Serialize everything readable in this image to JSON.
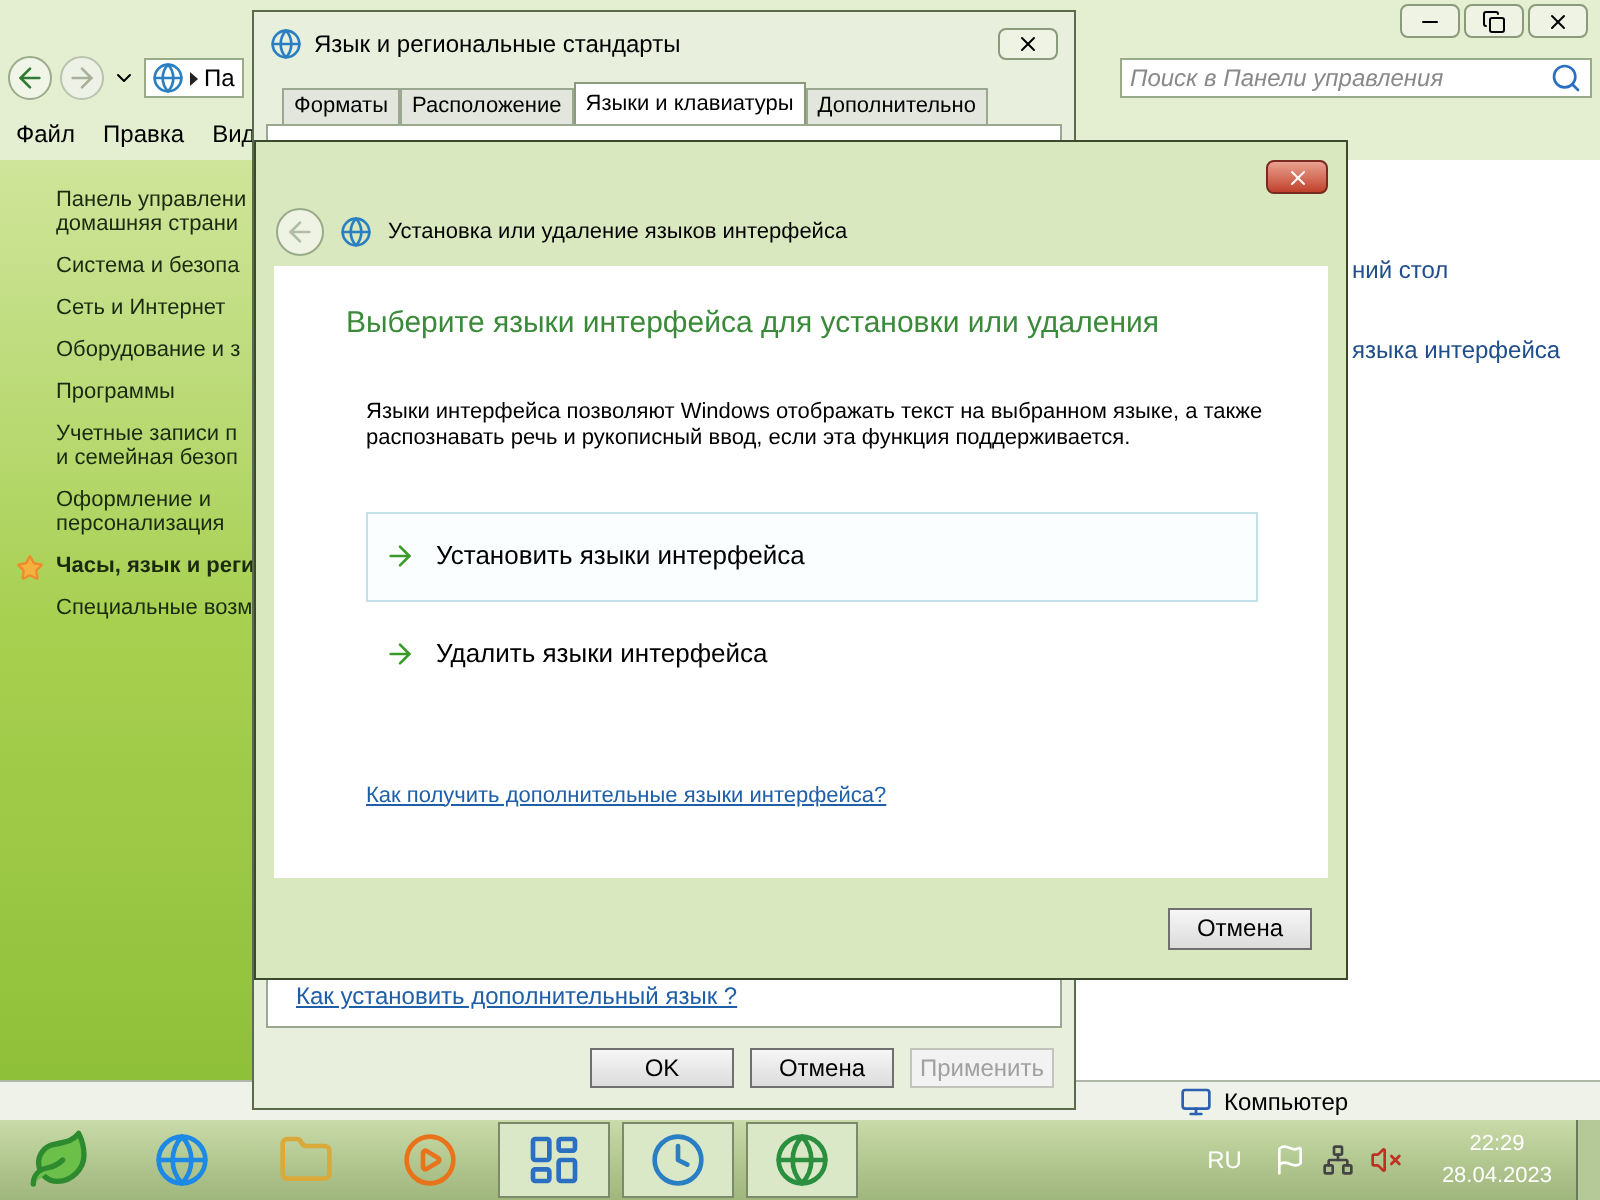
{
  "control_panel": {
    "address": "Па",
    "search": {
      "placeholder": "Поиск в Панели управления"
    },
    "menu": [
      "Файл",
      "Правка",
      "Вид"
    ],
    "sidebar": [
      {
        "label": "Панель управлени\nдомашняя страни",
        "selected": false
      },
      {
        "label": "Система и безопа",
        "selected": false
      },
      {
        "label": "Сеть и Интернет",
        "selected": false
      },
      {
        "label": "Оборудование и з",
        "selected": false
      },
      {
        "label": "Программы",
        "selected": false
      },
      {
        "label": "Учетные записи п\nи семейная безоп",
        "selected": false
      },
      {
        "label": "Оформление и\nперсонализация",
        "selected": false
      },
      {
        "label": "Часы, язык и реги",
        "selected": true
      },
      {
        "label": "Специальные возм",
        "selected": false
      }
    ],
    "content_links": [
      "ний стол",
      "языка интерфейса"
    ],
    "status_bar": "Компьютер"
  },
  "regional_window": {
    "title": "Язык и региональные стандарты",
    "tabs": [
      {
        "label": "Форматы",
        "selected": false
      },
      {
        "label": "Расположение",
        "selected": false
      },
      {
        "label": "Языки и клавиатуры",
        "selected": true
      },
      {
        "label": "Дополнительно",
        "selected": false
      }
    ],
    "link": "Как установить дополнительный язык ?",
    "buttons": [
      {
        "label": "OK",
        "disabled": false
      },
      {
        "label": "Отмена",
        "disabled": false
      },
      {
        "label": "Применить",
        "disabled": true
      }
    ]
  },
  "dialog": {
    "title": "Установка или удаление языков интерфейса",
    "heading": "Выберите языки интерфейса для установки или удаления",
    "description": "Языки интерфейса позволяют Windows отображать текст на выбранном языке, а также распознавать речь и рукописный ввод, если эта функция поддерживается.",
    "options": [
      {
        "label": "Установить языки интерфейса",
        "highlighted": true
      },
      {
        "label": "Удалить языки интерфейса",
        "highlighted": false
      }
    ],
    "link": "Как получить дополнительные языки интерфейса?",
    "cancel": "Отмена"
  },
  "taskbar": {
    "apps": [
      {
        "kind": "browser",
        "active": false
      },
      {
        "kind": "folder",
        "active": false
      },
      {
        "kind": "media",
        "active": false
      },
      {
        "kind": "panel",
        "active": true
      },
      {
        "kind": "globe-clock",
        "active": true
      },
      {
        "kind": "globe",
        "active": true
      }
    ],
    "language": "RU",
    "time": "22:29",
    "date": "28.04.2023"
  }
}
